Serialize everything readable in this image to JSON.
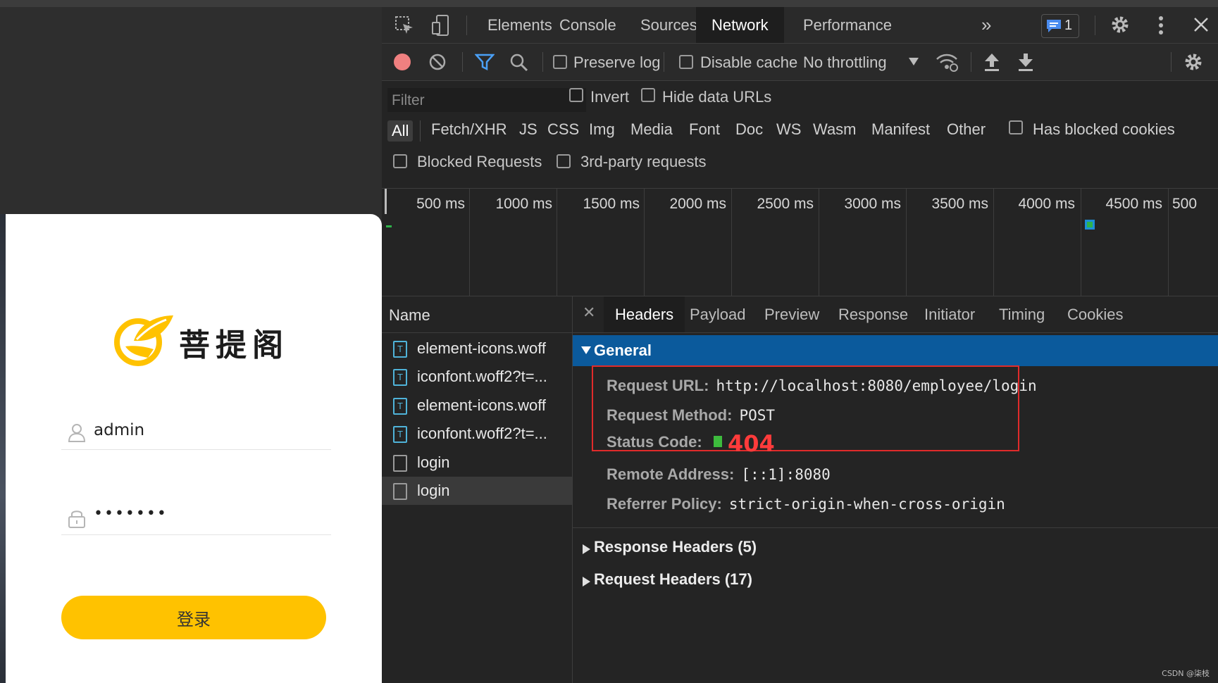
{
  "login": {
    "logo_text": "菩提阁",
    "username": "admin",
    "password_masked": "•••••••",
    "submit_label": "登录"
  },
  "devtools": {
    "tabs": [
      "Elements",
      "Console",
      "Sources",
      "Network",
      "Performance"
    ],
    "active_tab": "Network",
    "more_tabs_glyph": "»",
    "issues_count": "1",
    "toolbar": {
      "preserve_log": "Preserve log",
      "disable_cache": "Disable cache",
      "throttling": "No throttling"
    },
    "filter": {
      "placeholder": "Filter",
      "invert": "Invert",
      "hide_data_urls": "Hide data URLs",
      "types": [
        "All",
        "Fetch/XHR",
        "JS",
        "CSS",
        "Img",
        "Media",
        "Font",
        "Doc",
        "WS",
        "Wasm",
        "Manifest",
        "Other"
      ],
      "has_blocked_cookies": "Has blocked cookies",
      "blocked_requests": "Blocked Requests",
      "third_party": "3rd-party requests"
    },
    "timeline_ticks": [
      "500 ms",
      "1000 ms",
      "1500 ms",
      "2000 ms",
      "2500 ms",
      "3000 ms",
      "3500 ms",
      "4000 ms",
      "4500 ms",
      "500"
    ],
    "name_header": "Name",
    "requests": [
      {
        "name": "element-icons.woff",
        "type": "font"
      },
      {
        "name": "iconfont.woff2?t=...",
        "type": "font"
      },
      {
        "name": "element-icons.woff",
        "type": "font"
      },
      {
        "name": "iconfont.woff2?t=...",
        "type": "font"
      },
      {
        "name": "login",
        "type": "doc"
      },
      {
        "name": "login",
        "type": "doc"
      }
    ],
    "detail_tabs": [
      "Headers",
      "Payload",
      "Preview",
      "Response",
      "Initiator",
      "Timing",
      "Cookies"
    ],
    "general": {
      "title": "General",
      "request_url_label": "Request URL:",
      "request_url": "http://localhost:8080/employee/login",
      "request_method_label": "Request Method:",
      "request_method": "POST",
      "status_code_label": "Status Code:",
      "status_code": "404",
      "remote_address_label": "Remote Address:",
      "remote_address": "[::1]:8080",
      "referrer_policy_label": "Referrer Policy:",
      "referrer_policy": "strict-origin-when-cross-origin"
    },
    "response_headers": "Response Headers (5)",
    "request_headers": "Request Headers (17)"
  },
  "watermark": "CSDN @柒枝",
  "colors": {
    "accent_yellow": "#ffc200",
    "devtools_bg": "#242424",
    "general_bar": "#0b5a9c",
    "highlight_red": "#e02b2b"
  }
}
